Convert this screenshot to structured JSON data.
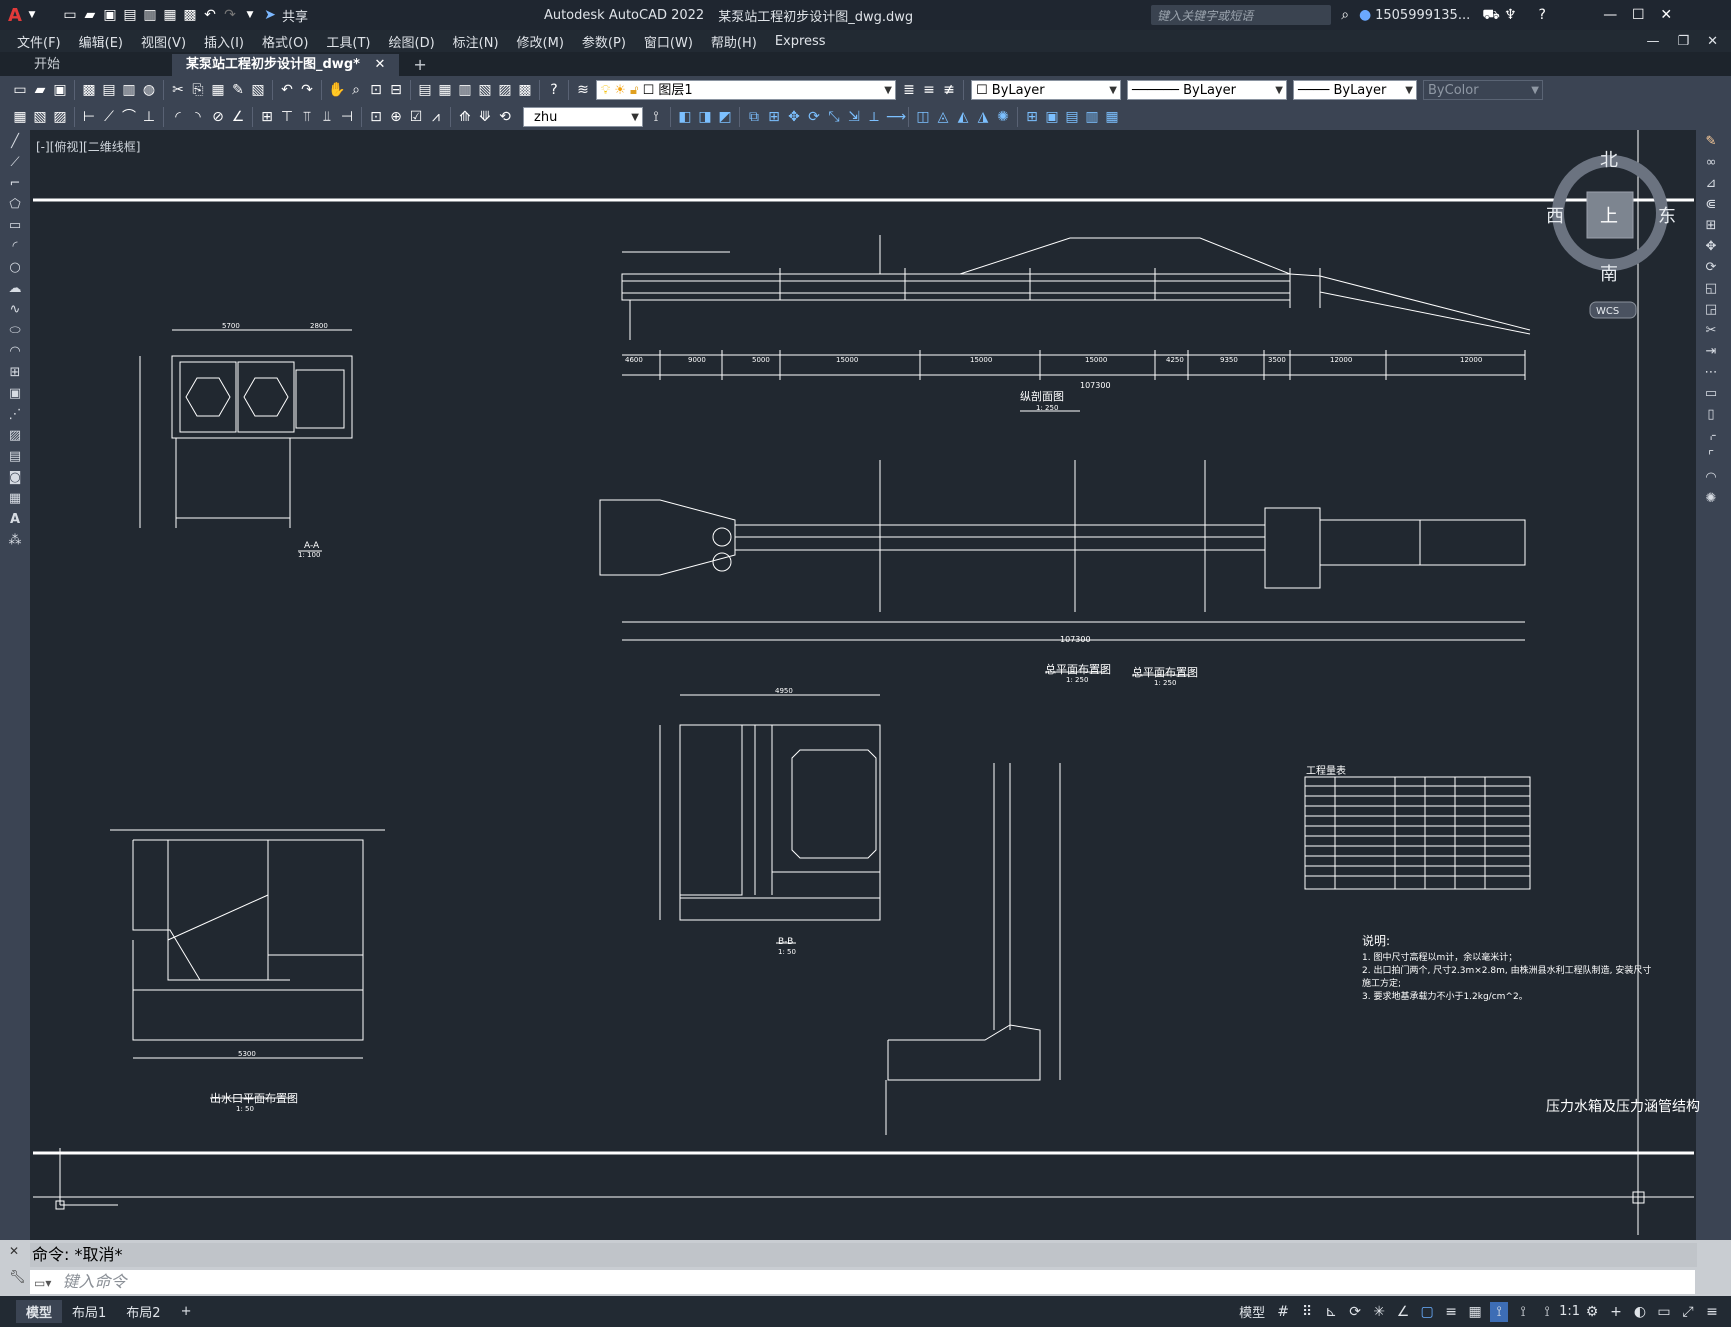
{
  "titlebar": {
    "app_title": "Autodesk AutoCAD 2022",
    "doc_title": "某泵站工程初步设计图_dwg.dwg",
    "share_label": "共享",
    "search_placeholder": "键入关键字或短语",
    "user_label": "1505999135..."
  },
  "menu": [
    "文件(F)",
    "编辑(E)",
    "视图(V)",
    "插入(I)",
    "格式(O)",
    "工具(T)",
    "绘图(D)",
    "标注(N)",
    "修改(M)",
    "参数(P)",
    "窗口(W)",
    "帮助(H)",
    "Express"
  ],
  "tabs": {
    "start": "开始",
    "drawing": "某泵站工程初步设计图_dwg*"
  },
  "toolbar": {
    "layer": "图层1",
    "color": "ByLayer",
    "linetype": "ByLayer",
    "lineweight": "ByLayer",
    "plotstyle": "ByColor",
    "dimstyle": "zhu"
  },
  "canvas": {
    "view_label": "[-][俯视][二维线框]",
    "compass": {
      "north": "北",
      "south": "南",
      "east": "东",
      "west": "西",
      "top": "上",
      "wcs": "WCS"
    },
    "drawing_titles": {
      "profile": "纵剖面图",
      "profile_scale": "1: 250",
      "plan": "总平面布置图",
      "plan_scale": "1: 250",
      "plan2": "总平面布置图",
      "plan2_scale": "1: 250",
      "section_aa": "A-A",
      "section_aa_scale": "1: 100",
      "section_bb": "B-B",
      "section_bb_scale": "1: 50",
      "outlet": "出水口平面布置图",
      "outlet_scale": "1: 50",
      "table_title": "工程量表",
      "right_title": "压力水箱及压力涵管结构"
    },
    "notes": {
      "heading": "说明:",
      "line1": "1. 图中尺寸高程以m计，余以毫米计；",
      "line2": "2. 出口拍门两个, 尺寸2.3m×2.8m, 由株洲县水利工程队制造, 安装尺寸",
      "line3": "施工方定;",
      "line4": "3. 要求地基承载力不小于1.2kg/cm^2。"
    },
    "dims": {
      "overall": "107300",
      "segments": [
        "4600",
        "9000",
        "5000",
        "15000",
        "15000",
        "15000",
        "4250",
        "9350",
        "3500",
        "12000",
        "12000"
      ],
      "aa_top": [
        "5700",
        "2800"
      ],
      "bb_top": "4950",
      "outlet_bottom": "5300"
    }
  },
  "command": {
    "history": "命令: *取消*",
    "placeholder": "键入命令"
  },
  "status": {
    "model_tab": "模型",
    "layout1": "布局1",
    "layout2": "布局2",
    "model_btn": "模型",
    "scale": "1:1"
  }
}
